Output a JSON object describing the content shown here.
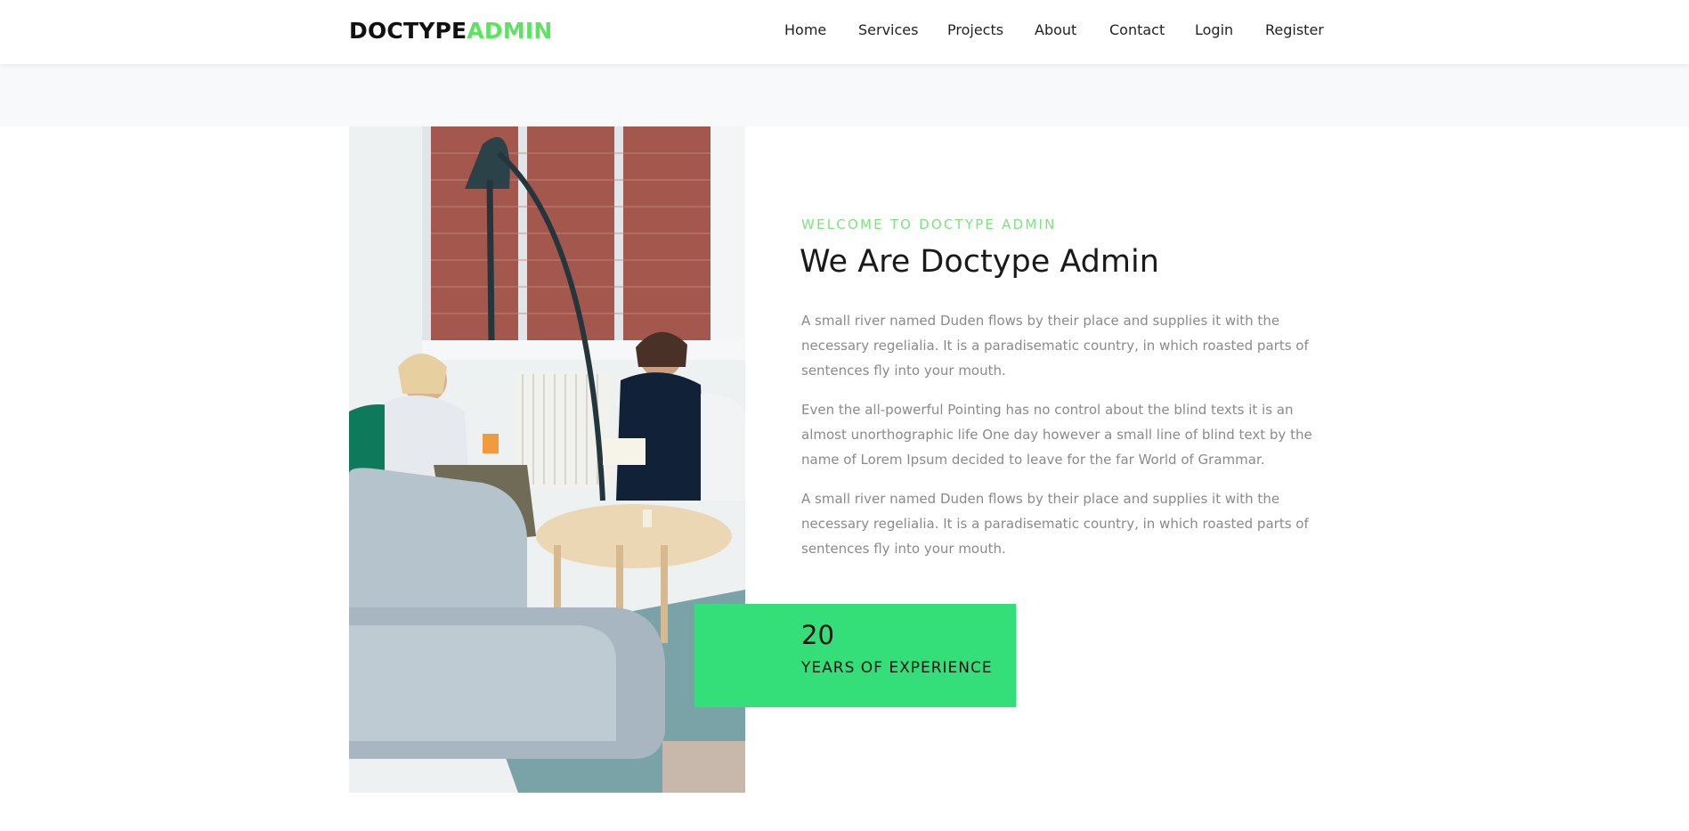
{
  "navbar": {
    "brand_primary": "DOCTYPE",
    "brand_accent": "ADMIN",
    "links": [
      {
        "label": "Home"
      },
      {
        "label": "Services"
      },
      {
        "label": "Projects"
      },
      {
        "label": "About"
      },
      {
        "label": "Contact"
      },
      {
        "label": "Login"
      },
      {
        "label": "Register"
      }
    ]
  },
  "about": {
    "eyebrow": "WELCOME TO DOCTYPE ADMIN",
    "heading": "We Are Doctype Admin",
    "paragraphs": [
      "A small river named Duden flows by their place and supplies it with the necessary regelialia. It is a paradisematic country, in which roasted parts of sentences fly into your mouth.",
      "Even the all-powerful Pointing has no control about the blind texts it is an almost unorthographic life One day however a small line of blind text by the name of Lorem Ipsum decided to leave for the far World of Grammar.",
      "A small river named Duden flows by their place and supplies it with the necessary regelialia. It is a paradisematic country, in which roasted parts of sentences fly into your mouth."
    ],
    "experience": {
      "number": "20",
      "label": "YEARS OF EXPERIENCE"
    }
  },
  "colors": {
    "accent": "#5ce35f",
    "experience_bg": "#34df7a",
    "band_bg": "#f8f9fa",
    "paragraph_text": "#8a8a8a"
  }
}
